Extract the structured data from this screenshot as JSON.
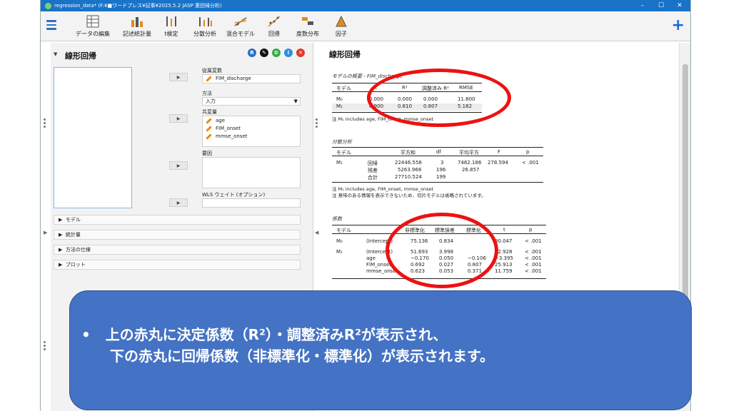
{
  "window": {
    "title": "regression_data* (F:¥■ワードプレス¥記事¥2025.5.2 JASP 重回帰分析)",
    "minimize": "–",
    "maximize": "☐",
    "close": "✕"
  },
  "toolbar": {
    "items": [
      {
        "label": "データの編集",
        "icon": "data-editor-icon"
      },
      {
        "label": "記述統計量",
        "icon": "descriptives-icon"
      },
      {
        "label": "t検定",
        "icon": "t-test-icon"
      },
      {
        "label": "分散分析",
        "icon": "anova-icon"
      },
      {
        "label": "混合モデル",
        "icon": "mixed-models-icon"
      },
      {
        "label": "回帰",
        "icon": "regression-icon"
      },
      {
        "label": "度数分布",
        "icon": "frequencies-icon"
      },
      {
        "label": "因子",
        "icon": "factor-icon"
      }
    ],
    "add_label": "+"
  },
  "analysis_panel": {
    "title": "線形回帰",
    "buttons": [
      {
        "label": "R",
        "color": "#2a6fc9"
      },
      {
        "label": "✎",
        "color": "#111111"
      },
      {
        "label": "©",
        "color": "#3aa946"
      },
      {
        "label": "i",
        "color": "#2e8ee0"
      },
      {
        "label": "✕",
        "color": "#e03a2f"
      }
    ],
    "dependent_label": "従属変数",
    "dependent_value": "FIM_discharge",
    "method_label": "方法",
    "method_value": "入力",
    "covariates_label": "共変量",
    "covariates": [
      "age",
      "FIM_onset",
      "mmse_onset"
    ],
    "factors_label": "要因",
    "wls_label": "WLS ウェイト (オプション)",
    "sections": [
      "モデル",
      "統計量",
      "方法の仕様",
      "プロット"
    ]
  },
  "results": {
    "title": "線形回帰",
    "model_summary": {
      "subtitle": "モデルの概要 - FIM_discharge",
      "headers": [
        "モデル",
        "R",
        "R²",
        "調整済み R²",
        "RMSE"
      ],
      "rows": [
        [
          "M₀",
          "0.000",
          "0.000",
          "0.000",
          "11.800"
        ],
        [
          "M₁",
          "0.900",
          "0.810",
          "0.807",
          "5.182"
        ]
      ],
      "note": "注 M₁ includes age, FIM_onset, mmse_onset"
    },
    "anova": {
      "subtitle": "分散分析",
      "headers": [
        "モデル",
        "",
        "平方和",
        "df",
        "平均平方",
        "F",
        "p"
      ],
      "rows": [
        [
          "M₁",
          "回帰",
          "22446.558",
          "3",
          "7482.186",
          "278.594",
          "< .001"
        ],
        [
          "",
          "残差",
          "5263.966",
          "196",
          "26.857",
          "",
          ""
        ],
        [
          "",
          "合計",
          "27710.524",
          "199",
          "",
          "",
          ""
        ]
      ],
      "notes": [
        "注 M₁ includes age, FIM_onset, mmse_onset",
        "注 意味のある情報を表示できないため、切片モデルは省略されています。"
      ]
    },
    "coefficients": {
      "subtitle": "係数",
      "headers": [
        "モデル",
        "",
        "非標準化",
        "標準誤差",
        "標準化",
        "t",
        "p"
      ],
      "rows": [
        [
          "M₀",
          "(Intercept)",
          "75.136",
          "0.834",
          "",
          "90.047",
          "< .001"
        ],
        [
          "M₁",
          "(Intercept)",
          "51.693",
          "3.998",
          "",
          "12.928",
          "< .001"
        ],
        [
          "",
          "age",
          "−0.170",
          "0.050",
          "−0.106",
          "−3.395",
          "< .001"
        ],
        [
          "",
          "FIM_onset",
          "0.692",
          "0.027",
          "0.807",
          "25.913",
          "< .001"
        ],
        [
          "",
          "mmse_onset",
          "0.623",
          "0.053",
          "0.371",
          "11.759",
          "< .001"
        ]
      ]
    }
  },
  "callout": {
    "bullet": "•",
    "line1": "上の赤丸に決定係数（R²）・調整済みR²が表示され、",
    "line2": "下の赤丸に回帰係数（非標準化・標準化）が表示されます。"
  },
  "colors": {
    "accent": "#1873c9",
    "highlight": "#ee1111",
    "callout": "#4472c4"
  }
}
